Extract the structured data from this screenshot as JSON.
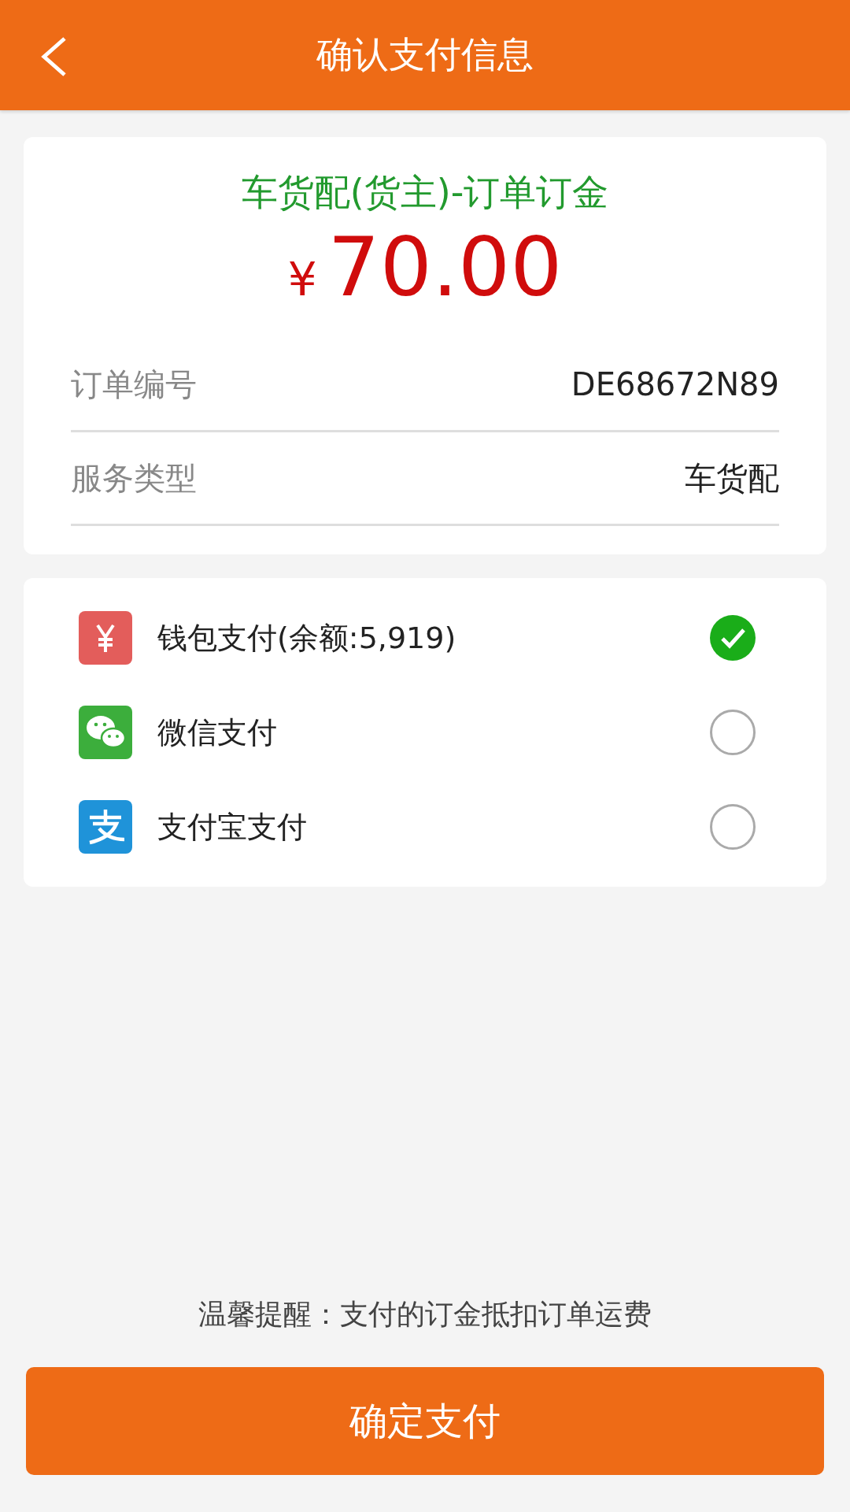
{
  "header": {
    "title": "确认支付信息"
  },
  "order": {
    "title": "车货配(货主)-订单订金",
    "currency": "¥",
    "amount": "70.00",
    "fields": [
      {
        "label": "订单编号",
        "value": "DE68672N89"
      },
      {
        "label": "服务类型",
        "value": "车货配"
      }
    ]
  },
  "payment_methods": [
    {
      "kind": "wallet",
      "label": "钱包支付(余额:5,919)",
      "selected": true
    },
    {
      "kind": "wechat",
      "label": "微信支付",
      "selected": false
    },
    {
      "kind": "alipay",
      "label": "支付宝支付",
      "selected": false
    }
  ],
  "hint": "温馨提醒：支付的订金抵扣订单运费",
  "confirm_button": "确定支付"
}
